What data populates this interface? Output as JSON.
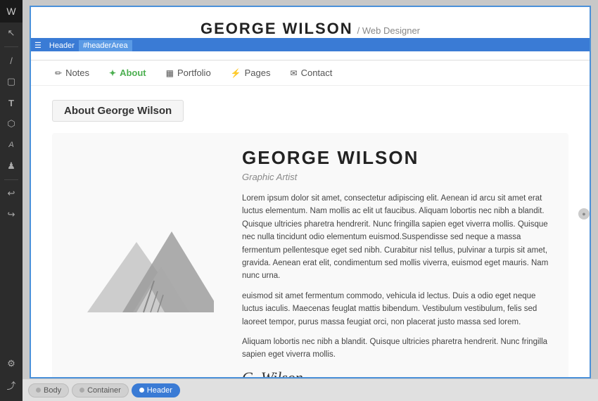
{
  "sidebar": {
    "logo": "W",
    "icons": [
      {
        "name": "cursor-icon",
        "symbol": "↖"
      },
      {
        "name": "slash-icon",
        "symbol": "/"
      },
      {
        "name": "square-icon",
        "symbol": "▢"
      },
      {
        "name": "text-icon",
        "symbol": "T"
      },
      {
        "name": "box-icon",
        "symbol": "⬡"
      },
      {
        "name": "letter-icon",
        "symbol": "A"
      },
      {
        "name": "figure-icon",
        "symbol": "♟"
      },
      {
        "name": "undo-icon",
        "symbol": "↩"
      },
      {
        "name": "redo-icon",
        "symbol": "↪"
      },
      {
        "name": "settings-icon",
        "symbol": "⚙"
      },
      {
        "name": "share-icon",
        "symbol": "⤴"
      }
    ]
  },
  "header": {
    "site_title": "GEORGE WILSON",
    "site_subtitle": "/ Web Designer",
    "tag_label": "Header",
    "tag_id": "#headerArea"
  },
  "nav": {
    "items": [
      {
        "label": "Notes",
        "icon": "✏",
        "active": false
      },
      {
        "label": "About",
        "icon": "✦",
        "active": true
      },
      {
        "label": "Portfolio",
        "icon": "▦",
        "active": false
      },
      {
        "label": "Pages",
        "icon": "⚡",
        "active": false
      },
      {
        "label": "Contact",
        "icon": "✉",
        "active": false
      }
    ]
  },
  "section": {
    "heading": "About George Wilson"
  },
  "about": {
    "name": "GEORGE WILSON",
    "title": "Graphic Artist",
    "body1": "Lorem ipsum dolor sit amet, consectetur adipiscing elit. Aenean id arcu sit amet erat luctus elementum. Nam mollis ac elit ut faucibus. Aliquam lobortis nec nibh a blandit. Quisque ultricies pharetra hendrerit. Nunc fringilla sapien eget viverra mollis. Quisque nec nulla tincidunt odio elementum euismod.Suspendisse sed neque a massa fermentum pellentesque eget sed nibh. Curabitur nisl tellus, pulvinar a turpis sit amet, gravida. Aenean erat elit, condimentum sed mollis viverra, euismod eget mauris. Nam nunc urna.",
    "body2": "euismod sit amet fermentum commodo, vehicula id lectus. Duis a odio eget neque luctus iaculis. Maecenas feuglat mattis bibendum. Vestibulum vestibulum, felis sed laoreet tempor, purus massa feugiat orci, non placerat justo massa sed lorem.",
    "body3": "Aliquam lobortis nec nibh a blandit. Quisque ultricies pharetra hendrerit. Nunc fringilla sapien eget viverra mollis.",
    "signature": "G. Wilson"
  },
  "bottom_bar": {
    "items": [
      {
        "label": "Body",
        "icon": "○",
        "active": false
      },
      {
        "label": "Container",
        "icon": "○",
        "active": false
      },
      {
        "label": "Header",
        "icon": "●",
        "active": true
      }
    ]
  }
}
